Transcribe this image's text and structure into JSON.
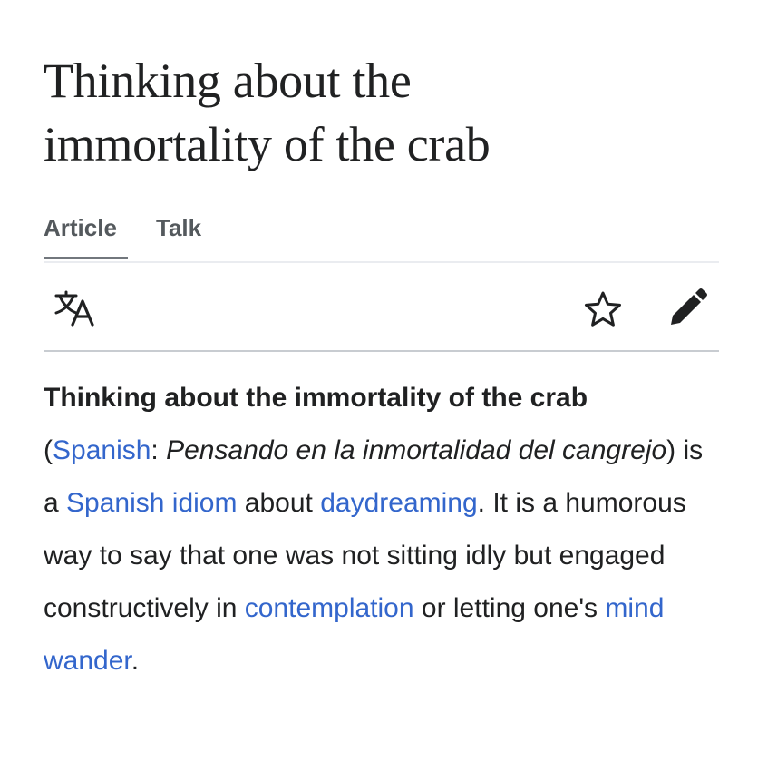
{
  "article": {
    "title_line1": "Thinking about the",
    "title_line2": "immortality of the crab"
  },
  "tabs": {
    "article": "Article",
    "talk": "Talk"
  },
  "toolbar": {
    "language_icon": "language-icon",
    "watch_icon": "star-icon",
    "edit_icon": "pencil-icon"
  },
  "lead": {
    "bold_title": "Thinking about the immortality of the crab",
    "paren_open": "(",
    "spanish_link": "Spanish",
    "colon": ": ",
    "spanish_name": "Pensando en la inmortalidad del cangrejo",
    "text_1": ") is a ",
    "idiom_link": "Spanish idiom",
    "text_2": " about ",
    "daydreaming_link": "daydreaming",
    "text_3": ". It is a humorous way to say that one was not sitting idly but engaged constructively in ",
    "contemplation_link": "contemplation",
    "text_4": " or letting one's ",
    "mind_wander_link": "mind wander",
    "text_5": "."
  },
  "colors": {
    "text": "#202122",
    "link": "#3366cc",
    "tab_text": "#54595d",
    "divider": "#c8ccd1"
  }
}
